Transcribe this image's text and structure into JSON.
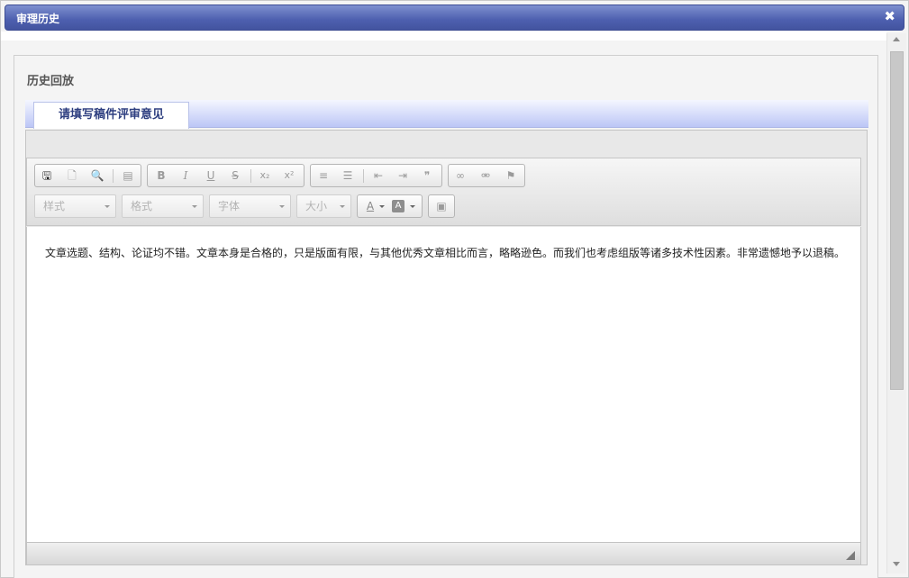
{
  "dialog": {
    "title": "审理历史",
    "close_glyph": "✖"
  },
  "panel": {
    "title": "历史回放"
  },
  "tab": {
    "label": "请填写稿件评审意见"
  },
  "toolbar": {
    "row1": [
      {
        "icon": "save-icon",
        "glyph": "🖫"
      },
      {
        "icon": "new-page-icon",
        "glyph": "🗋"
      },
      {
        "icon": "preview-icon",
        "glyph": "🔍"
      },
      {
        "icon": "templates-icon",
        "glyph": "▤"
      },
      {
        "icon": "bold-icon",
        "glyph": "B"
      },
      {
        "icon": "italic-icon",
        "glyph": "I"
      },
      {
        "icon": "underline-icon",
        "glyph": "U"
      },
      {
        "icon": "strike-icon",
        "glyph": "S"
      },
      {
        "icon": "subscript-icon",
        "glyph": "x₂"
      },
      {
        "icon": "superscript-icon",
        "glyph": "x²"
      },
      {
        "icon": "numbered-list-icon",
        "glyph": "≡"
      },
      {
        "icon": "bulleted-list-icon",
        "glyph": "☰"
      },
      {
        "icon": "outdent-icon",
        "glyph": "⇤"
      },
      {
        "icon": "indent-icon",
        "glyph": "⇥"
      },
      {
        "icon": "blockquote-icon",
        "glyph": "❞"
      },
      {
        "icon": "link-icon",
        "glyph": "∞"
      },
      {
        "icon": "unlink-icon",
        "glyph": "⚮"
      },
      {
        "icon": "anchor-flag-icon",
        "glyph": "⚑"
      }
    ],
    "combos": {
      "styles": "样式",
      "format": "格式",
      "font": "字体",
      "size": "大小"
    },
    "text_color_glyph": "A",
    "bg_color_glyph": "A",
    "image_glyph": "▣"
  },
  "content": {
    "text": "文章选题、结构、论证均不错。文章本身是合格的，只是版面有限，与其他优秀文章相比而言，略略逊色。而我们也考虑组版等诸多技术性因素。非常遗憾地予以退稿。"
  }
}
